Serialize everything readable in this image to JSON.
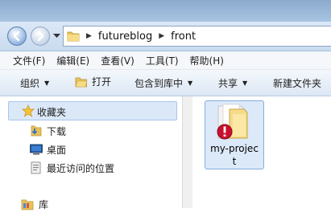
{
  "address": {
    "crumbs": [
      "futureblog",
      "front"
    ]
  },
  "menu": [
    "文件(F)",
    "编辑(E)",
    "查看(V)",
    "工具(T)",
    "帮助(H)"
  ],
  "toolbar": {
    "organize": "组织",
    "open": "打开",
    "include_library": "包含到库中",
    "share": "共享",
    "new_folder": "新建文件夹"
  },
  "nav": {
    "favorites": "收藏夹",
    "downloads": "下载",
    "desktop": "桌面",
    "recent": "最近访问的位置",
    "library": "库"
  },
  "file": {
    "name_line1": "my-projec",
    "name_line2": "t"
  },
  "colors": {
    "selection": "#dce9f8",
    "selection_border": "#84acdd",
    "error_badge": "#c8102e",
    "folder": "#f2d36a"
  }
}
